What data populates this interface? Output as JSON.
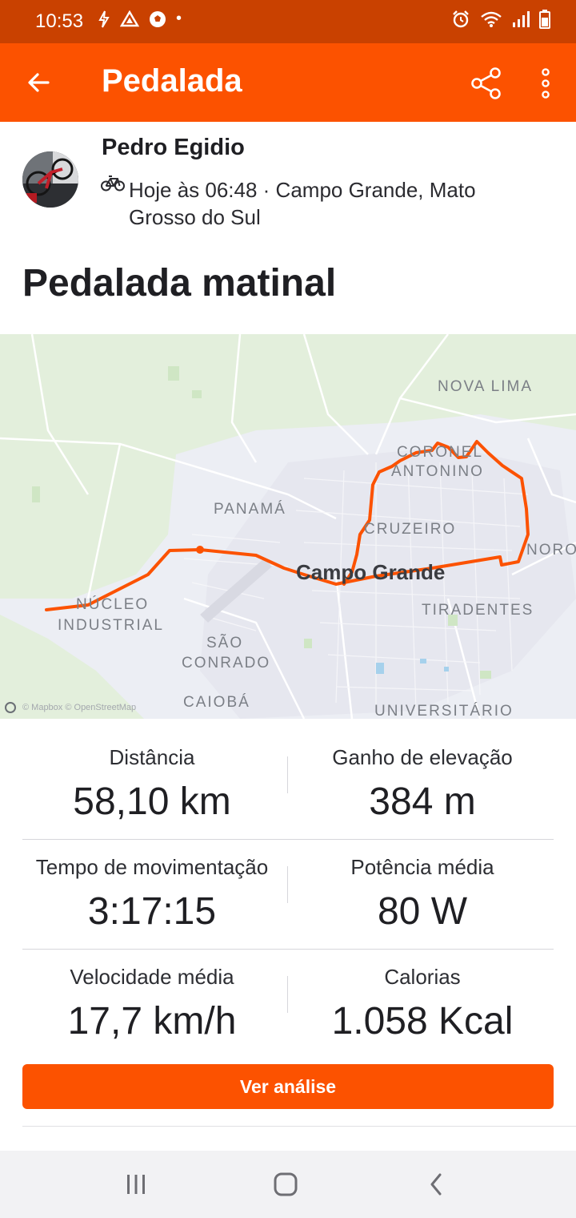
{
  "status_bar": {
    "time": "10:53",
    "dot": "•",
    "left_icons": [
      "signal-arrow-icon",
      "drive-icon",
      "soccer-icon"
    ],
    "right_icons": [
      "alarm-icon",
      "wifi-icon",
      "signal-icon",
      "battery-icon"
    ]
  },
  "app_bar": {
    "title": "Pedalada",
    "back_icon": "arrow-back-icon",
    "share_icon": "share-icon",
    "more_icon": "more-vert-icon",
    "color": "#fc5200"
  },
  "athlete": {
    "name": "Pedro Egidio",
    "meta": "Hoje às 06:48 · Campo Grande, Mato Grosso do Sul",
    "activity_icon": "bike-icon"
  },
  "activity": {
    "title": "Pedalada matinal"
  },
  "map": {
    "labels": {
      "nova_lima": "NOVA LIMA",
      "coronel": "CORONEL",
      "antonino": "ANTONINO",
      "panama": "PANAMÁ",
      "cruzeiro": "CRUZEIRO",
      "noro": "NORO",
      "campo_grande": "Campo Grande",
      "nucleo": "NÚCLEO",
      "industrial": "INDUSTRIAL",
      "tiradentes": "TIRADENTES",
      "sao": "SÃO",
      "conrado": "CONRADO",
      "caioba": "CAIOBÁ",
      "universitario": "UNIVERSITÁRIO"
    },
    "attribution": "© Mapbox © OpenStreetMap",
    "route_color": "#fc5200"
  },
  "stats": [
    {
      "label": "Distância",
      "value": "58,10 km"
    },
    {
      "label": "Ganho de elevação",
      "value": "384 m"
    },
    {
      "label": "Tempo de movimentação",
      "value": "3:17:15"
    },
    {
      "label": "Potência média",
      "value": "80 W"
    },
    {
      "label": "Velocidade média",
      "value": "17,7 km/h"
    },
    {
      "label": "Calorias",
      "value": "1.058 Kcal"
    }
  ],
  "analysis_button": {
    "label": "Ver análise"
  },
  "nav": {
    "recents_icon": "recents-icon",
    "home_icon": "home-icon",
    "back_icon": "nav-back-icon"
  }
}
